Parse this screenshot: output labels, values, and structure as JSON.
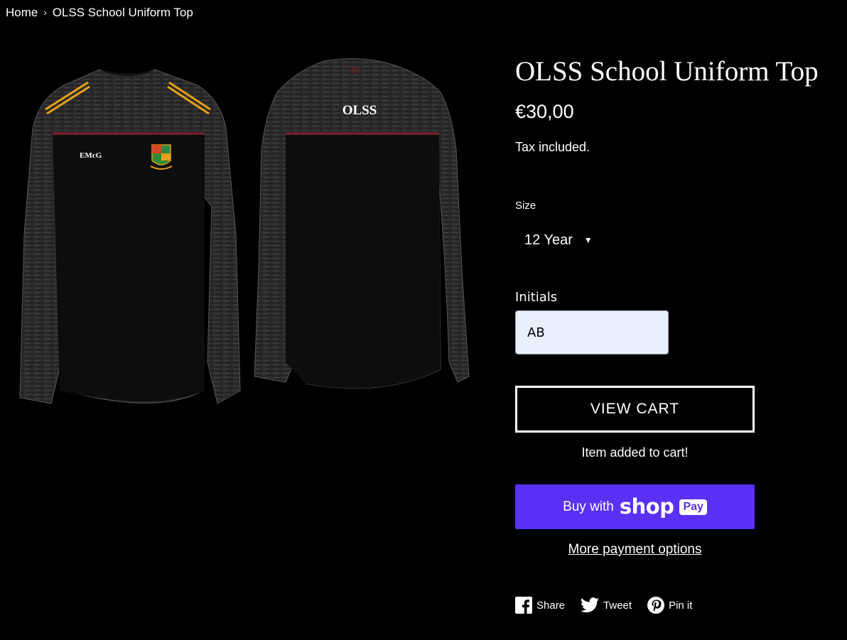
{
  "breadcrumb": {
    "home": "Home",
    "separator": "›",
    "current": "OLSS School Uniform Top"
  },
  "product": {
    "title": "OLSS School Uniform Top",
    "price": "€30,00",
    "tax_note": "Tax included.",
    "image_front_initials": "EMcG",
    "image_back_text": "OLSS"
  },
  "size": {
    "label": "Size",
    "selected": "12 Year"
  },
  "initials": {
    "label": "Initials",
    "value": "AB"
  },
  "actions": {
    "view_cart": "VIEW CART",
    "added_message": "Item added to cart!",
    "buy_with": "Buy with",
    "shop_word": "shop",
    "pay_badge": "Pay",
    "more_options": "More payment options"
  },
  "social": {
    "share": "Share",
    "tweet": "Tweet",
    "pin": "Pin it"
  },
  "colors": {
    "background": "#000000",
    "shop_pay": "#5a31f4",
    "input_bg": "#e8f0fe",
    "maroon_stripe": "#6b1f2a",
    "gold_stripe": "#e3a01b"
  }
}
